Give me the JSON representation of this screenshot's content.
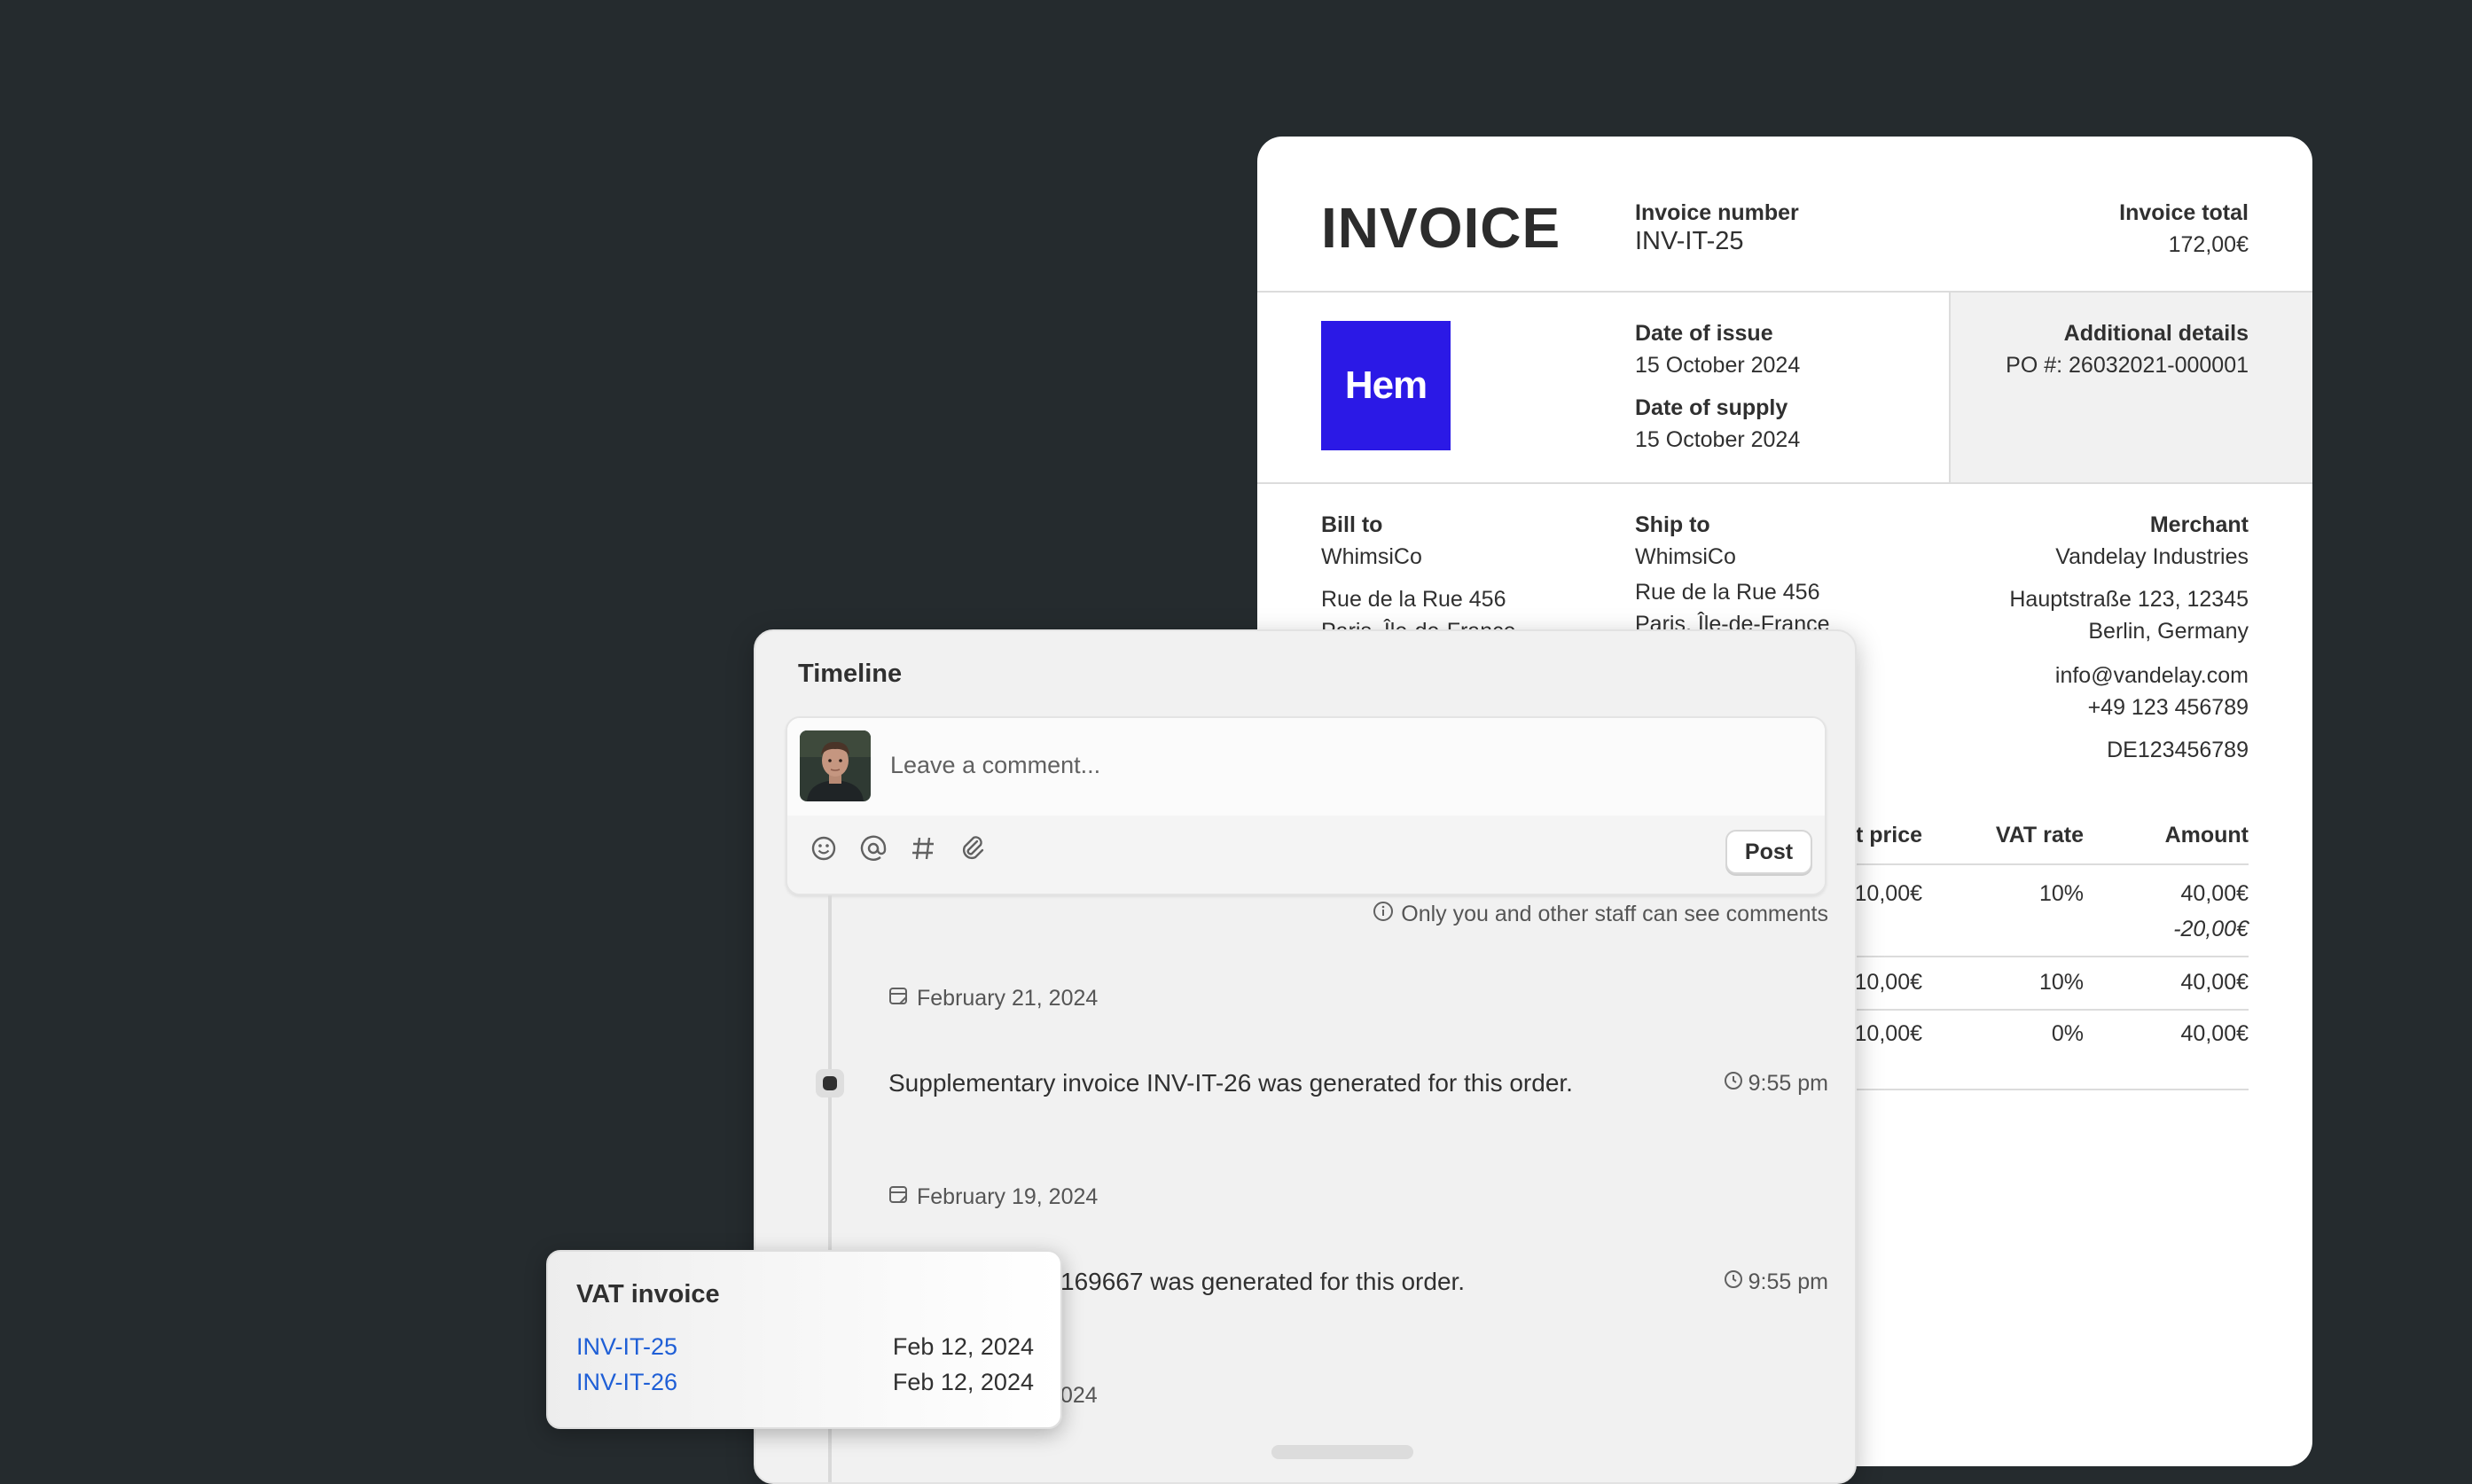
{
  "invoice": {
    "title": "INVOICE",
    "number_label": "Invoice number",
    "number": "INV-IT-25",
    "total_label": "Invoice total",
    "total": "172,00€",
    "logo_text": "Hem",
    "date_issue_label": "Date of issue",
    "date_issue": "15 October 2024",
    "date_supply_label": "Date of supply",
    "date_supply": "15 October 2024",
    "additional_label": "Additional details",
    "additional_value": "PO #: 26032021-000001",
    "bill_to": {
      "label": "Bill to",
      "name": "WhimsiCo",
      "street": "Rue de la Rue 456",
      "city": "Paris, Île-de-France"
    },
    "ship_to": {
      "label": "Ship to",
      "name": "WhimsiCo",
      "street": "Rue de la Rue 456",
      "city": "Paris, Île-de-France"
    },
    "merchant": {
      "label": "Merchant",
      "name": "Vandelay Industries",
      "street": "Hauptstraße 123, 12345",
      "city": "Berlin, Germany",
      "email": "info@vandelay.com",
      "phone": "+49 123 456789",
      "vat_id": "DE123456789"
    },
    "table": {
      "headers": {
        "unit_price": "Unit price",
        "vat_rate": "VAT rate",
        "amount": "Amount"
      },
      "rows": [
        {
          "unit_price": "10,00€",
          "vat_rate": "10%",
          "amount": "40,00€",
          "discount": "-20,00€"
        },
        {
          "unit_price": "10,00€",
          "vat_rate": "10%",
          "amount": "40,00€"
        },
        {
          "unit_price": "10,00€",
          "vat_rate": "0%",
          "amount": "40,00€"
        }
      ]
    }
  },
  "timeline": {
    "title": "Timeline",
    "comment_placeholder": "Leave a comment...",
    "tools": [
      "emoji-icon",
      "mention-icon",
      "hashtag-icon",
      "attachment-icon"
    ],
    "post_label": "Post",
    "staff_note": "Only you and other staff can see comments",
    "events": [
      {
        "date": "February 21, 2024",
        "text": "Supplementary invoice INV-IT-26 was generated for this order.",
        "time": "9:55 pm"
      },
      {
        "date": "February 19, 2024",
        "text": "169667 was generated for this order.",
        "time": "9:55 pm"
      },
      {
        "date": "024"
      }
    ]
  },
  "vat_popover": {
    "title": "VAT invoice",
    "items": [
      {
        "id": "INV-IT-25",
        "date": "Feb 12, 2024"
      },
      {
        "id": "INV-IT-26",
        "date": "Feb 12, 2024"
      }
    ]
  },
  "colors": {
    "background": "#252b2e",
    "brand_logo": "#2b19e6",
    "link": "#1f5fd6"
  }
}
